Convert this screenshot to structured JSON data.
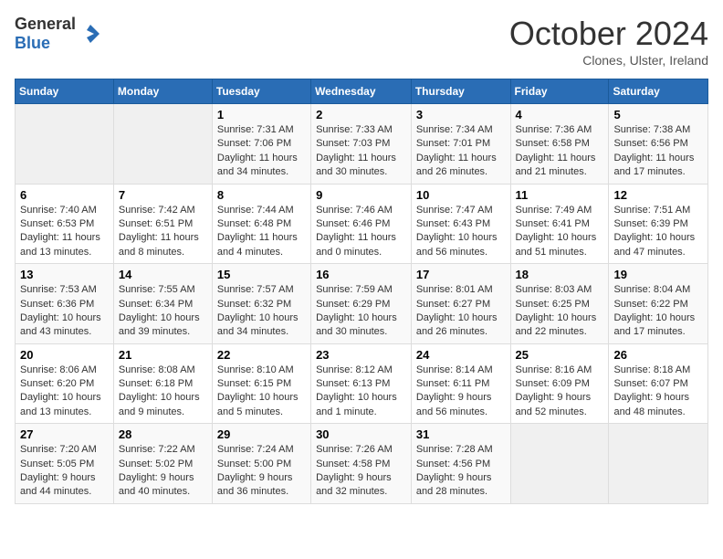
{
  "logo": {
    "general": "General",
    "blue": "Blue"
  },
  "title": "October 2024",
  "subtitle": "Clones, Ulster, Ireland",
  "days_of_week": [
    "Sunday",
    "Monday",
    "Tuesday",
    "Wednesday",
    "Thursday",
    "Friday",
    "Saturday"
  ],
  "weeks": [
    [
      {
        "day": "",
        "info": ""
      },
      {
        "day": "",
        "info": ""
      },
      {
        "day": "1",
        "info": "Sunrise: 7:31 AM\nSunset: 7:06 PM\nDaylight: 11 hours\nand 34 minutes."
      },
      {
        "day": "2",
        "info": "Sunrise: 7:33 AM\nSunset: 7:03 PM\nDaylight: 11 hours\nand 30 minutes."
      },
      {
        "day": "3",
        "info": "Sunrise: 7:34 AM\nSunset: 7:01 PM\nDaylight: 11 hours\nand 26 minutes."
      },
      {
        "day": "4",
        "info": "Sunrise: 7:36 AM\nSunset: 6:58 PM\nDaylight: 11 hours\nand 21 minutes."
      },
      {
        "day": "5",
        "info": "Sunrise: 7:38 AM\nSunset: 6:56 PM\nDaylight: 11 hours\nand 17 minutes."
      }
    ],
    [
      {
        "day": "6",
        "info": "Sunrise: 7:40 AM\nSunset: 6:53 PM\nDaylight: 11 hours\nand 13 minutes."
      },
      {
        "day": "7",
        "info": "Sunrise: 7:42 AM\nSunset: 6:51 PM\nDaylight: 11 hours\nand 8 minutes."
      },
      {
        "day": "8",
        "info": "Sunrise: 7:44 AM\nSunset: 6:48 PM\nDaylight: 11 hours\nand 4 minutes."
      },
      {
        "day": "9",
        "info": "Sunrise: 7:46 AM\nSunset: 6:46 PM\nDaylight: 11 hours\nand 0 minutes."
      },
      {
        "day": "10",
        "info": "Sunrise: 7:47 AM\nSunset: 6:43 PM\nDaylight: 10 hours\nand 56 minutes."
      },
      {
        "day": "11",
        "info": "Sunrise: 7:49 AM\nSunset: 6:41 PM\nDaylight: 10 hours\nand 51 minutes."
      },
      {
        "day": "12",
        "info": "Sunrise: 7:51 AM\nSunset: 6:39 PM\nDaylight: 10 hours\nand 47 minutes."
      }
    ],
    [
      {
        "day": "13",
        "info": "Sunrise: 7:53 AM\nSunset: 6:36 PM\nDaylight: 10 hours\nand 43 minutes."
      },
      {
        "day": "14",
        "info": "Sunrise: 7:55 AM\nSunset: 6:34 PM\nDaylight: 10 hours\nand 39 minutes."
      },
      {
        "day": "15",
        "info": "Sunrise: 7:57 AM\nSunset: 6:32 PM\nDaylight: 10 hours\nand 34 minutes."
      },
      {
        "day": "16",
        "info": "Sunrise: 7:59 AM\nSunset: 6:29 PM\nDaylight: 10 hours\nand 30 minutes."
      },
      {
        "day": "17",
        "info": "Sunrise: 8:01 AM\nSunset: 6:27 PM\nDaylight: 10 hours\nand 26 minutes."
      },
      {
        "day": "18",
        "info": "Sunrise: 8:03 AM\nSunset: 6:25 PM\nDaylight: 10 hours\nand 22 minutes."
      },
      {
        "day": "19",
        "info": "Sunrise: 8:04 AM\nSunset: 6:22 PM\nDaylight: 10 hours\nand 17 minutes."
      }
    ],
    [
      {
        "day": "20",
        "info": "Sunrise: 8:06 AM\nSunset: 6:20 PM\nDaylight: 10 hours\nand 13 minutes."
      },
      {
        "day": "21",
        "info": "Sunrise: 8:08 AM\nSunset: 6:18 PM\nDaylight: 10 hours\nand 9 minutes."
      },
      {
        "day": "22",
        "info": "Sunrise: 8:10 AM\nSunset: 6:15 PM\nDaylight: 10 hours\nand 5 minutes."
      },
      {
        "day": "23",
        "info": "Sunrise: 8:12 AM\nSunset: 6:13 PM\nDaylight: 10 hours\nand 1 minute."
      },
      {
        "day": "24",
        "info": "Sunrise: 8:14 AM\nSunset: 6:11 PM\nDaylight: 9 hours\nand 56 minutes."
      },
      {
        "day": "25",
        "info": "Sunrise: 8:16 AM\nSunset: 6:09 PM\nDaylight: 9 hours\nand 52 minutes."
      },
      {
        "day": "26",
        "info": "Sunrise: 8:18 AM\nSunset: 6:07 PM\nDaylight: 9 hours\nand 48 minutes."
      }
    ],
    [
      {
        "day": "27",
        "info": "Sunrise: 7:20 AM\nSunset: 5:05 PM\nDaylight: 9 hours\nand 44 minutes."
      },
      {
        "day": "28",
        "info": "Sunrise: 7:22 AM\nSunset: 5:02 PM\nDaylight: 9 hours\nand 40 minutes."
      },
      {
        "day": "29",
        "info": "Sunrise: 7:24 AM\nSunset: 5:00 PM\nDaylight: 9 hours\nand 36 minutes."
      },
      {
        "day": "30",
        "info": "Sunrise: 7:26 AM\nSunset: 4:58 PM\nDaylight: 9 hours\nand 32 minutes."
      },
      {
        "day": "31",
        "info": "Sunrise: 7:28 AM\nSunset: 4:56 PM\nDaylight: 9 hours\nand 28 minutes."
      },
      {
        "day": "",
        "info": ""
      },
      {
        "day": "",
        "info": ""
      }
    ]
  ]
}
